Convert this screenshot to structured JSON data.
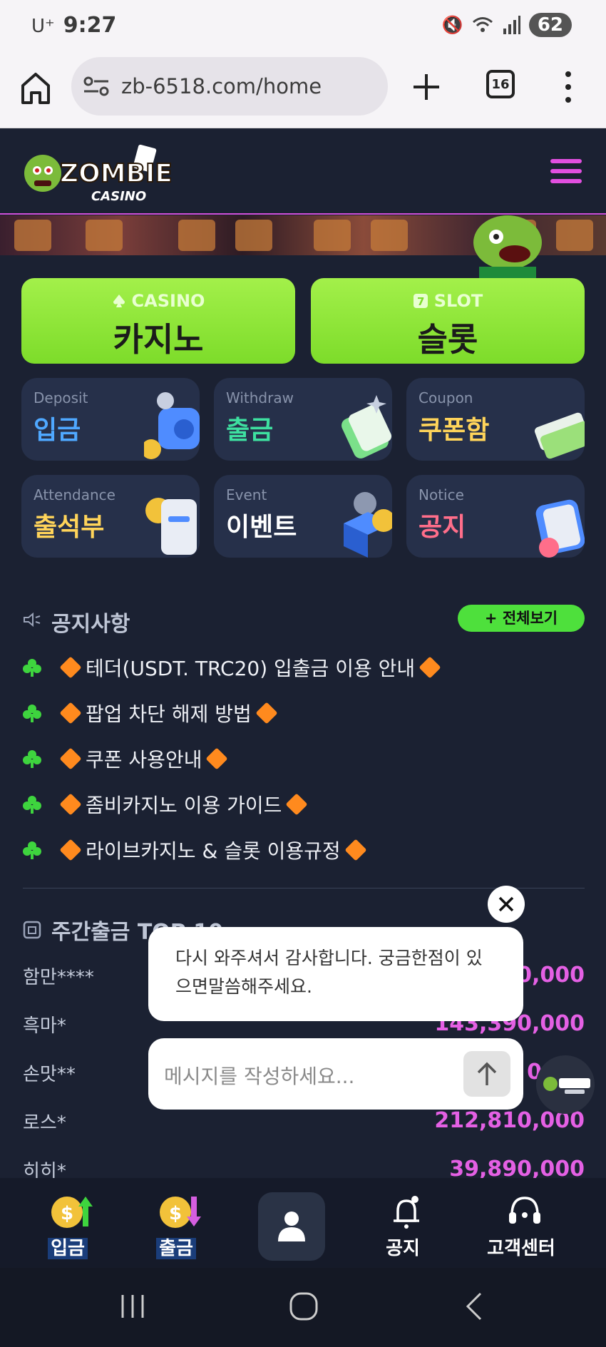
{
  "status_bar": {
    "carrier": "U⁺",
    "time": "9:27",
    "battery": "62"
  },
  "browser": {
    "url": "zb-6518.com/home",
    "tab_count": "16"
  },
  "site": {
    "logo_text": "ZOMBIE",
    "logo_sub": "CASINO"
  },
  "main_buttons": [
    {
      "sub": "CASINO",
      "label": "카지노"
    },
    {
      "sub": "SLOT",
      "label": "슬롯"
    }
  ],
  "menu_cards": [
    {
      "en": "Deposit",
      "ko": "입금",
      "color": "#4fa8ff"
    },
    {
      "en": "Withdraw",
      "ko": "출금",
      "color": "#3ee0a0"
    },
    {
      "en": "Coupon",
      "ko": "쿠폰함",
      "color": "#ffd45a"
    },
    {
      "en": "Attendance",
      "ko": "출석부",
      "color": "#ffd45a"
    },
    {
      "en": "Event",
      "ko": "이벤트",
      "color": "#ffffff"
    },
    {
      "en": "Notice",
      "ko": "공지",
      "color": "#ff6e8a"
    }
  ],
  "notices": {
    "title": "공지사항",
    "view_all": "+ 전체보기",
    "items": [
      "테더(USDT. TRC20) 입출금 이용 안내",
      "팝업 차단 해제 방법",
      "쿠폰 사용안내",
      "좀비카지노 이용 가이드",
      "라이브카지노 & 슬롯 이용규정"
    ]
  },
  "weekly_top": {
    "title": "주간출금 TOP 10",
    "rows": [
      {
        "name": "함만****",
        "amount": "0,000"
      },
      {
        "name": "흑마*",
        "amount": "143,390,000"
      },
      {
        "name": "손맛**",
        "amount": "0"
      },
      {
        "name": "로스*",
        "amount": "212,810,000"
      },
      {
        "name": "히히*",
        "amount": "39,890,000"
      }
    ]
  },
  "chat": {
    "message": "다시 와주셔서 감사합니다. 궁금한점이 있으면말씀해주세요.",
    "placeholder": "메시지를 작성하세요..."
  },
  "bottom_nav": {
    "deposit": "입금",
    "withdraw": "출금",
    "notice": "공지",
    "support": "고객센터"
  },
  "colors": {
    "background": "#1b2132",
    "accent_green": "#8be235",
    "accent_pink": "#e460e4"
  }
}
